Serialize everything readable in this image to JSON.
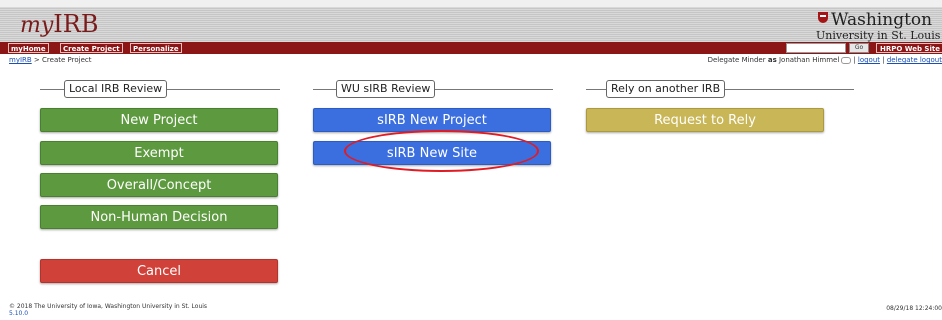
{
  "header": {
    "logo_prefix": "my",
    "logo_suffix": "IRB",
    "institution_name": "Washington",
    "institution_sub": "University in St. Louis"
  },
  "nav": {
    "items": [
      "myHome",
      "Create Project",
      "Personalize"
    ],
    "go_label": "Go",
    "web_link": "HRPO Web Site"
  },
  "breadcrumb": {
    "home": "myIRB",
    "separator": " > ",
    "current": "Create Project"
  },
  "delegate": {
    "user": "Delegate Minder",
    "as_word": "as",
    "delegate_of": "Jonathan Himmel",
    "logout": "logout",
    "delegate_logout": "delegate logout"
  },
  "sections": {
    "local": {
      "title": "Local IRB Review",
      "buttons": [
        "New Project",
        "Exempt",
        "Overall/Concept",
        "Non-Human Decision"
      ]
    },
    "sirb": {
      "title": "WU sIRB Review",
      "buttons": [
        "sIRB New Project",
        "sIRB New Site"
      ]
    },
    "rely": {
      "title": "Rely on another IRB",
      "buttons": [
        "Request to Rely"
      ]
    }
  },
  "cancel_label": "Cancel",
  "footer": {
    "copyright": "© 2018 The University of Iowa, Washington University in St. Louis",
    "version": "5.10.0",
    "timestamp": "08/29/18 12:24:00"
  },
  "colors": {
    "nav_bar": "#8c1515",
    "green_button": "#5d9a3f",
    "blue_button": "#3b6fe0",
    "olive_button": "#c9b656",
    "red_button": "#d0413a",
    "annotation_circle": "#e01b24"
  }
}
